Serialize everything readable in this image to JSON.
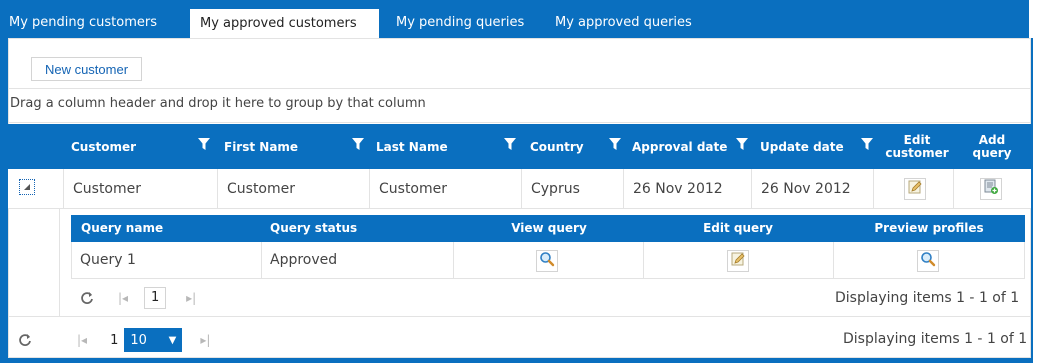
{
  "tabs": [
    {
      "label": "My pending customers",
      "active": false
    },
    {
      "label": "My approved customers",
      "active": true
    },
    {
      "label": "My pending queries",
      "active": false
    },
    {
      "label": "My approved queries",
      "active": false
    }
  ],
  "toolbar": {
    "new_customer_label": "New customer"
  },
  "group_hint": "Drag a column header and drop it here to group by that column",
  "grid": {
    "columns": {
      "customer": "Customer",
      "first_name": "First Name",
      "last_name": "Last Name",
      "country": "Country",
      "approval_date": "Approval date",
      "update_date": "Update date",
      "edit_customer_l1": "Edit",
      "edit_customer_l2": "customer",
      "add_query_l1": "Add",
      "add_query_l2": "query"
    },
    "row": {
      "customer": "Customer",
      "first_name": "Customer",
      "last_name": "Customer",
      "country": "Cyprus",
      "approval_date": "26 Nov 2012",
      "update_date": "26 Nov 2012"
    }
  },
  "detail": {
    "columns": {
      "query_name": "Query name",
      "query_status": "Query status",
      "view_query": "View query",
      "edit_query": "Edit query",
      "preview_profiles": "Preview profiles"
    },
    "row": {
      "query_name": "Query 1",
      "query_status": "Approved"
    },
    "pager": {
      "page": "1",
      "status": "Displaying items 1 - 1 of 1"
    }
  },
  "pager": {
    "page": "1",
    "page_size": "10",
    "status": "Displaying items 1 - 1 of 1"
  },
  "colors": {
    "accent": "#0a6fbf",
    "link": "#1464b4"
  }
}
